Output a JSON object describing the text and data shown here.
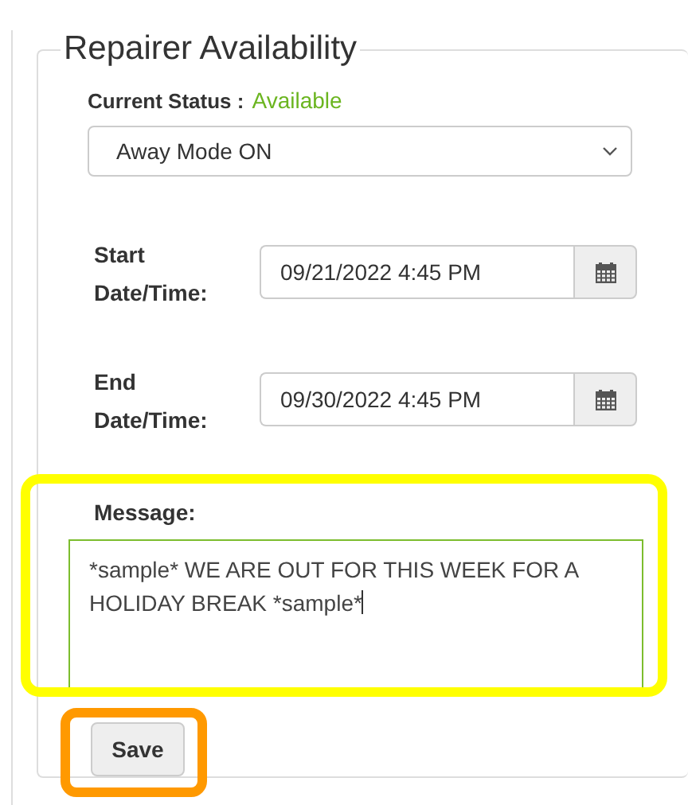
{
  "panel": {
    "title": "Repairer Availability"
  },
  "status": {
    "label": "Current Status :",
    "value": "Available"
  },
  "mode_select": {
    "value": "Away Mode ON"
  },
  "date_fields": [
    {
      "label": "Start Date/Time:",
      "value": "09/21/2022 4:45 PM"
    },
    {
      "label": "End Date/Time:",
      "value": "09/30/2022 4:45 PM"
    }
  ],
  "message": {
    "label": "Message:",
    "value": "*sample* WE ARE OUT FOR THIS WEEK FOR A HOLIDAY BREAK *sample*",
    "color": "#ffff00"
  },
  "save_button": {
    "label": "Save",
    "color": "#ff9900"
  }
}
